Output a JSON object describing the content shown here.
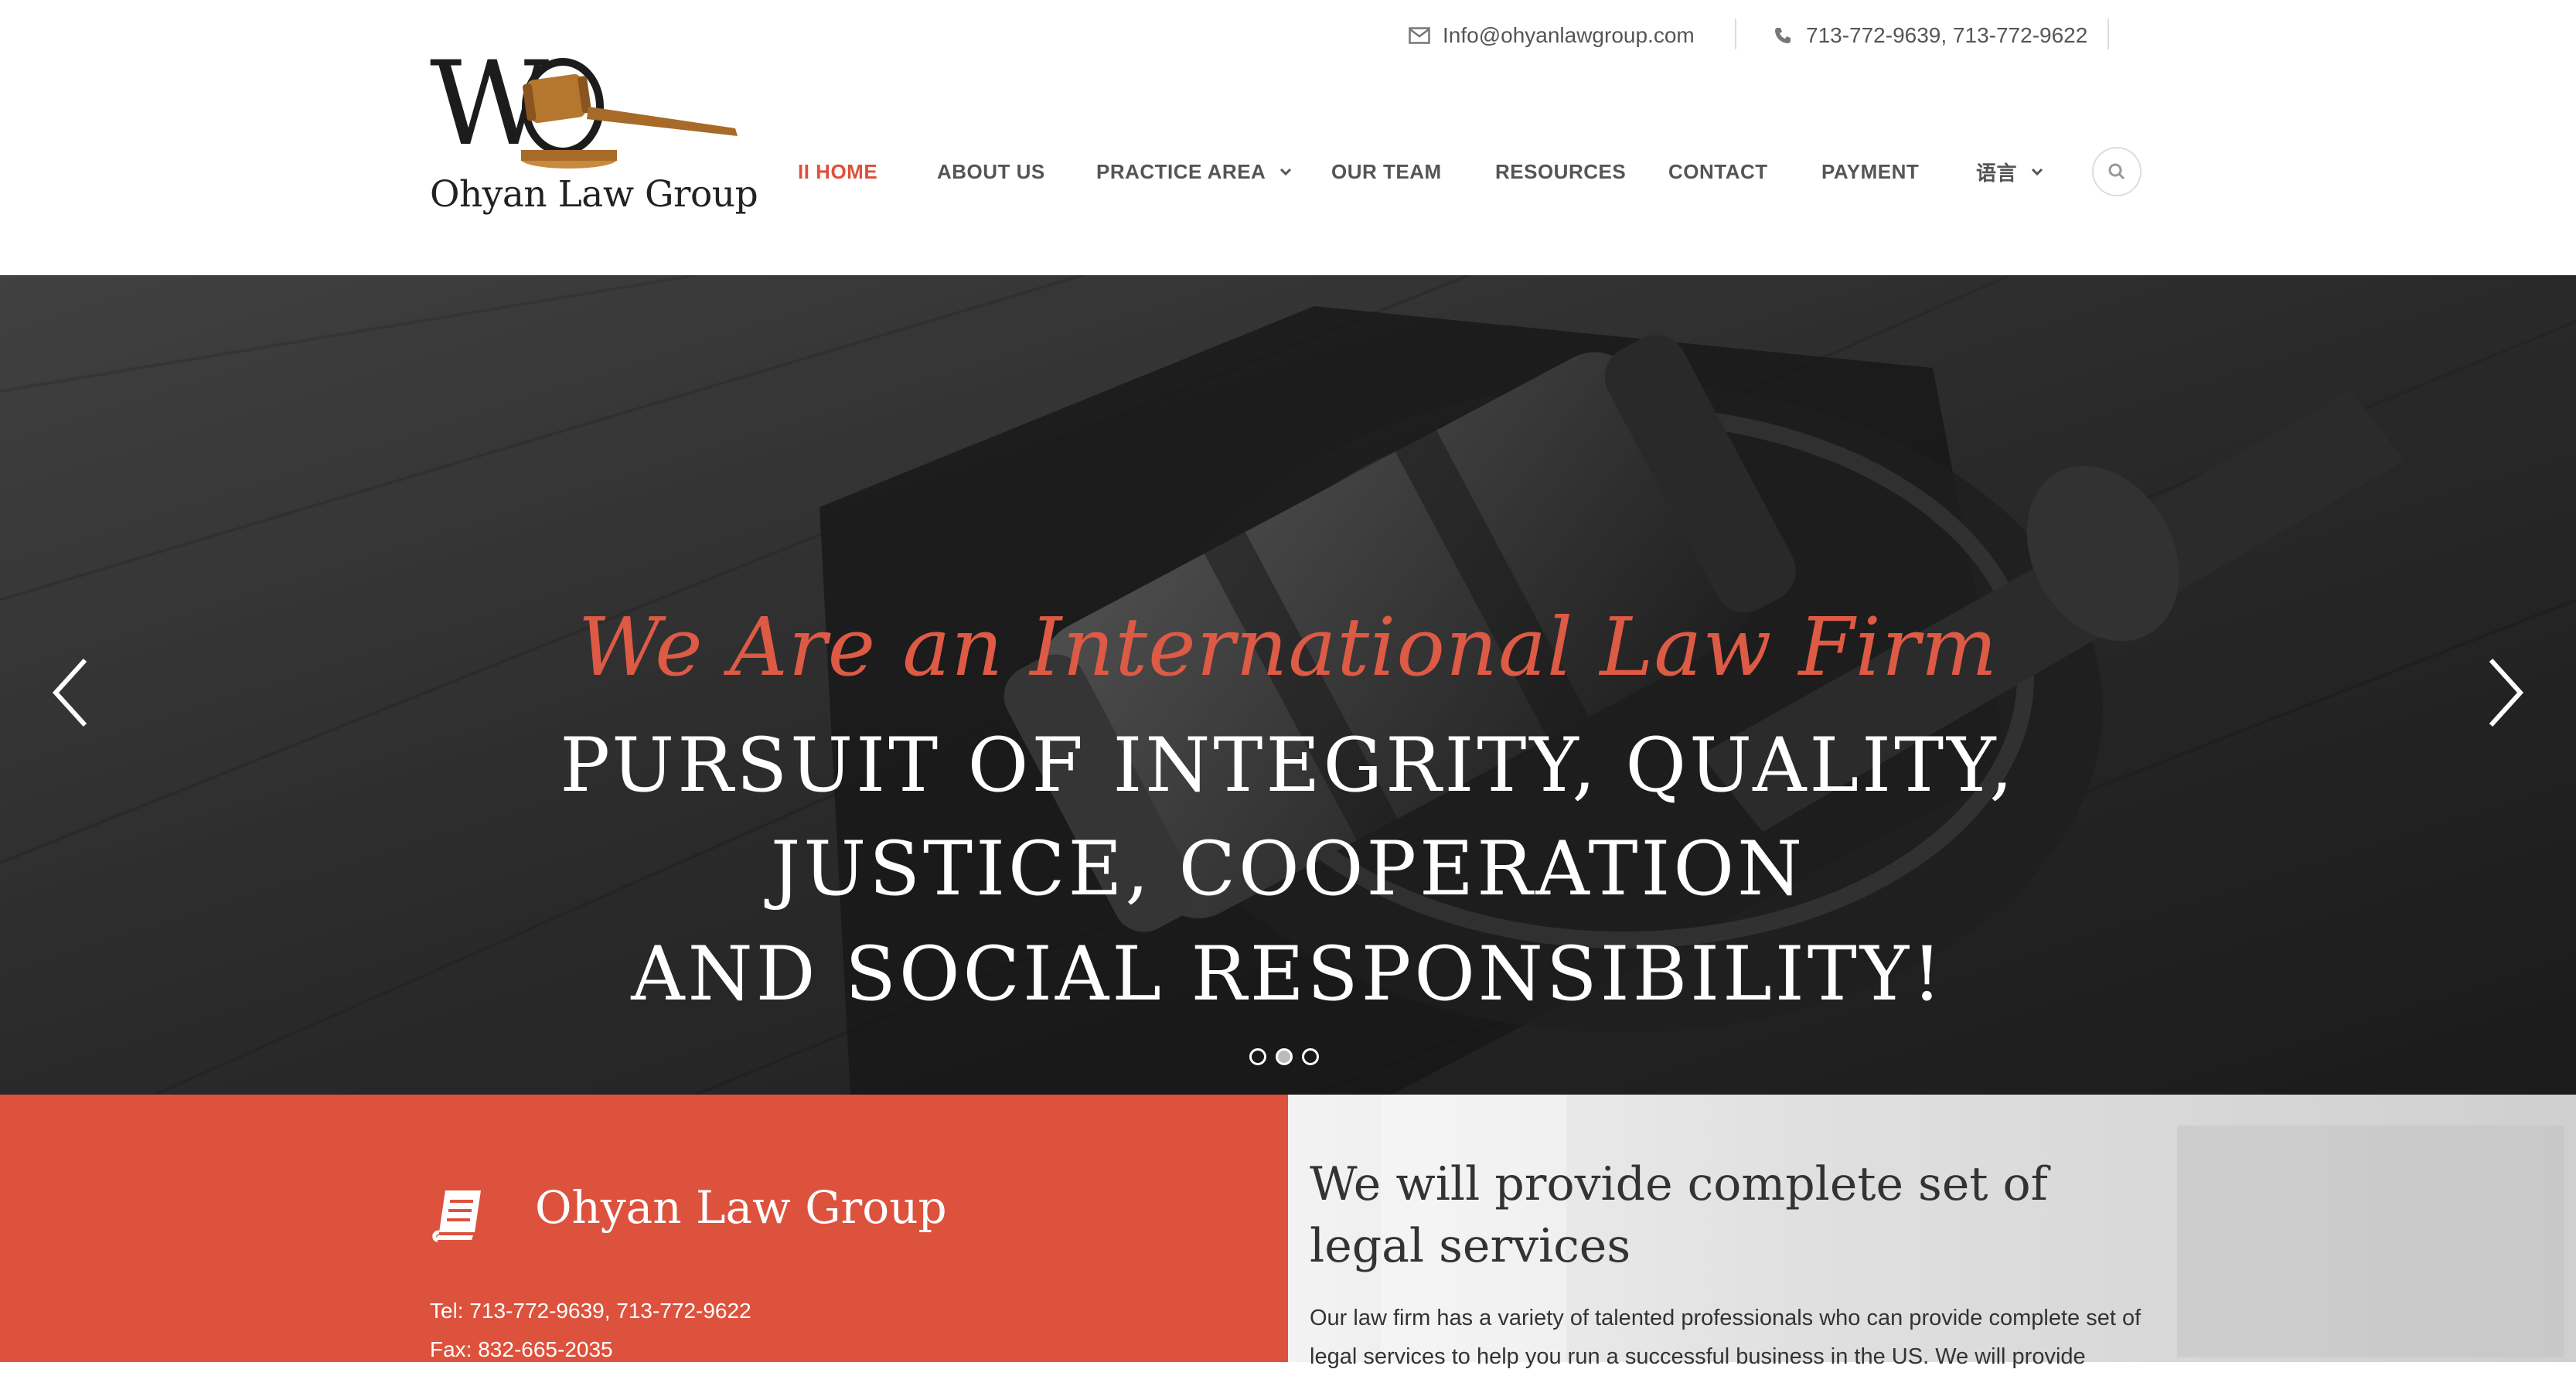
{
  "topbar": {
    "email": "Info@ohyanlawgroup.com",
    "phones": "713-772-9639, 713-772-9622"
  },
  "logo": {
    "monogram": "WO",
    "name": "Ohyan Law Group"
  },
  "nav": {
    "items": [
      {
        "label": "II HOME",
        "active": true
      },
      {
        "label": "ABOUT US"
      },
      {
        "label": "PRACTICE AREA",
        "dropdown": true
      },
      {
        "label": "OUR TEAM"
      },
      {
        "label": "RESOURCES"
      },
      {
        "label": "CONTACT"
      },
      {
        "label": "PAYMENT"
      },
      {
        "label": "语言",
        "dropdown": true
      }
    ]
  },
  "hero": {
    "subtitle": "We Are an International Law Firm",
    "lines": [
      "PURSUIT OF INTEGRITY, QUALITY,",
      "JUSTICE, COOPERATION",
      "AND SOCIAL RESPONSIBILITY!"
    ],
    "slides": 3,
    "active_slide": 2
  },
  "firm": {
    "name": "Ohyan Law Group",
    "tel": "Tel: 713-772-9639, 713-772-9622",
    "fax": "Fax: 832-665-2035"
  },
  "services": {
    "title": "We will provide complete set of legal services",
    "text": "Our law firm has a variety of talented professionals who can provide complete set of legal services to help you run a successful business in the US. We will provide"
  },
  "colors": {
    "accent": "#dd523d",
    "nav_text": "#555555"
  },
  "icons": [
    "envelope-icon",
    "phone-icon",
    "search-icon",
    "chevron-down-icon",
    "arrow-left-icon",
    "arrow-right-icon",
    "book-icon",
    "gavel-logo"
  ]
}
